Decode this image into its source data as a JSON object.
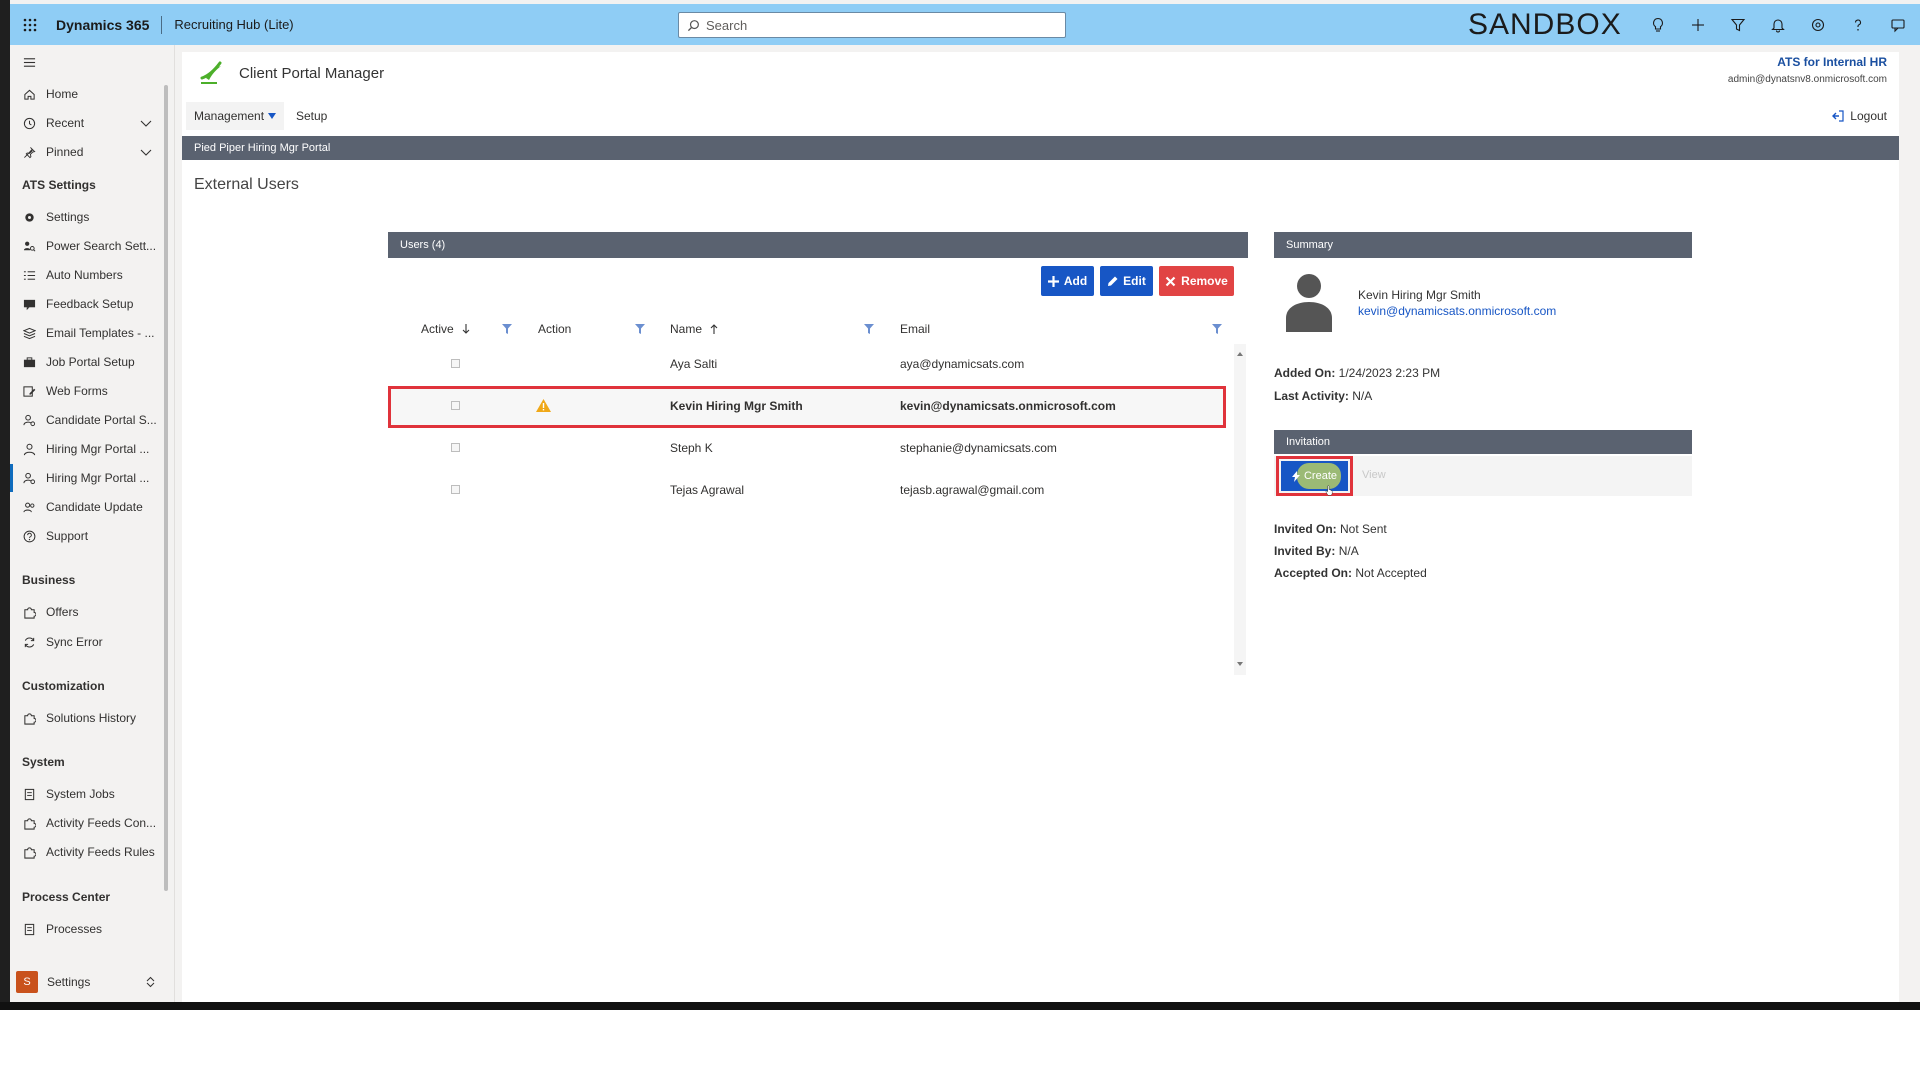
{
  "topbar": {
    "app_name": "Dynamics 365",
    "app_sub": "Recruiting Hub (Lite)",
    "search_placeholder": "Search",
    "environment": "SANDBOX",
    "icons": [
      "lightbulb-icon",
      "plus-icon",
      "filter-icon",
      "bell-icon",
      "gear-icon",
      "help-icon",
      "chat-icon"
    ]
  },
  "sidebar": {
    "top_items": [
      {
        "label": "Home",
        "icon": "home-icon"
      },
      {
        "label": "Recent",
        "icon": "clock-icon"
      },
      {
        "label": "Pinned",
        "icon": "pin-icon"
      }
    ],
    "sections": [
      {
        "title": "ATS Settings",
        "items": [
          {
            "label": "Settings"
          },
          {
            "label": "Power Search Sett..."
          },
          {
            "label": "Auto Numbers"
          },
          {
            "label": "Feedback Setup"
          },
          {
            "label": "Email Templates - ..."
          },
          {
            "label": "Job Portal Setup"
          },
          {
            "label": "Web Forms"
          },
          {
            "label": "Candidate Portal S..."
          },
          {
            "label": "Hiring Mgr Portal ..."
          },
          {
            "label": "Hiring Mgr Portal ..."
          },
          {
            "label": "Candidate Update"
          },
          {
            "label": "Support"
          }
        ]
      },
      {
        "title": "Business",
        "items": [
          {
            "label": "Offers"
          },
          {
            "label": "Sync Error"
          }
        ]
      },
      {
        "title": "Customization",
        "items": [
          {
            "label": "Solutions History"
          }
        ]
      },
      {
        "title": "System",
        "items": [
          {
            "label": "System Jobs"
          },
          {
            "label": "Activity Feeds Con..."
          },
          {
            "label": "Activity Feeds Rules"
          }
        ]
      },
      {
        "title": "Process Center",
        "items": [
          {
            "label": "Processes"
          }
        ]
      }
    ],
    "area": {
      "badge": "S",
      "label": "Settings"
    }
  },
  "portal": {
    "title": "Client Portal Manager",
    "org": "ATS for Internal HR",
    "account": "admin@dynatsnv8.onmicrosoft.com",
    "menu": {
      "management": "Management",
      "setup": "Setup",
      "logout": "Logout"
    },
    "breadcrumb": "Pied Piper Hiring Mgr Portal",
    "page_title": "External Users"
  },
  "users": {
    "header": "Users (4)",
    "buttons": {
      "add": "Add",
      "edit": "Edit",
      "remove": "Remove"
    },
    "columns": {
      "active": "Active",
      "action": "Action",
      "name": "Name",
      "email": "Email"
    },
    "rows": [
      {
        "name": "Aya Salti",
        "email": "aya@dynamicsats.com"
      },
      {
        "name": "Kevin Hiring Mgr Smith",
        "email": "kevin@dynamicsats.onmicrosoft.com"
      },
      {
        "name": "Steph K",
        "email": "stephanie@dynamicsats.com"
      },
      {
        "name": "Tejas Agrawal",
        "email": "tejasb.agrawal@gmail.com"
      }
    ]
  },
  "summary": {
    "header": "Summary",
    "name": "Kevin Hiring Mgr Smith",
    "email": "kevin@dynamicsats.onmicrosoft.com",
    "added_on_label": "Added On:",
    "added_on": "1/24/2023 2:23 PM",
    "last_activity_label": "Last Activity:",
    "last_activity": "N/A",
    "invitation_header": "Invitation",
    "create_label": "Create",
    "view_label": "View",
    "invited_on_label": "Invited On:",
    "invited_on": "Not Sent",
    "invited_by_label": "Invited By:",
    "invited_by": "N/A",
    "accepted_on_label": "Accepted On:",
    "accepted_on": "Not Accepted"
  }
}
